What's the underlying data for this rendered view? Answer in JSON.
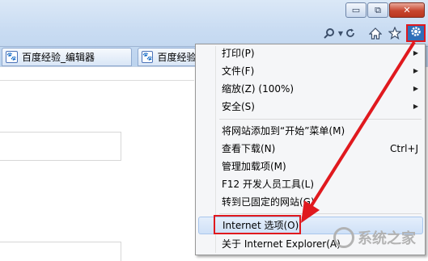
{
  "window": {
    "minimize_glyph": "▭",
    "restore_glyph": "⧉",
    "close_glyph": "✕"
  },
  "toolbar": {
    "search_icon": "search-icon",
    "refresh_icon": "refresh-icon",
    "home_icon": "home-icon",
    "favorites_icon": "star-icon",
    "tools_icon": "gear-icon"
  },
  "tabs": [
    {
      "label": "百度经验_编辑器"
    },
    {
      "label": "百度经验"
    }
  ],
  "menu": {
    "items": [
      {
        "label": "打印(P)",
        "submenu": true
      },
      {
        "label": "文件(F)",
        "submenu": true
      },
      {
        "label": "缩放(Z) (100%)",
        "submenu": true
      },
      {
        "label": "安全(S)",
        "submenu": true
      },
      {
        "label": "将网站添加到“开始”菜单(M)"
      },
      {
        "label": "查看下载(N)",
        "shortcut": "Ctrl+J"
      },
      {
        "label": "管理加载项(M)"
      },
      {
        "label": "F12 开发人员工具(L)"
      },
      {
        "label": "转到已固定的网站(G)"
      },
      {
        "label": "Internet 选项(O)"
      },
      {
        "label": "关于 Internet Explorer(A)"
      }
    ]
  },
  "watermark": {
    "text": "系统之家"
  },
  "colors": {
    "highlight": "#e0191e",
    "accent": "#2f6fb9"
  }
}
